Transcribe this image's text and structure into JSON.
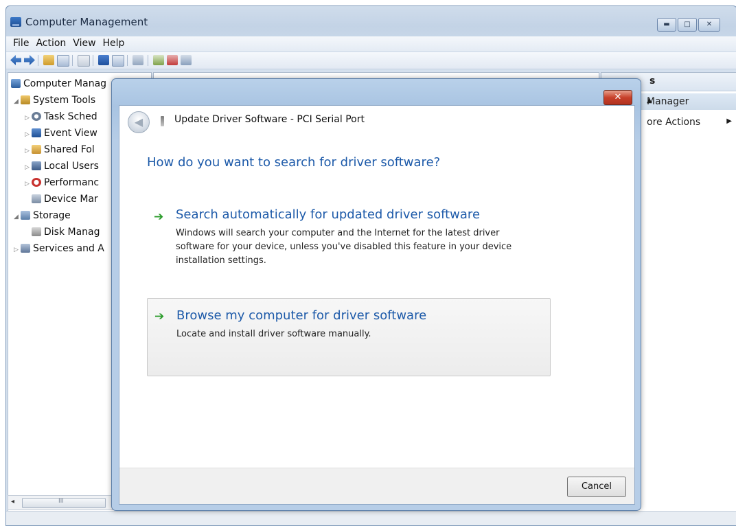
{
  "window": {
    "title": "Computer Management",
    "controls": {
      "minimize": "▬",
      "maximize": "□",
      "close": "✕"
    }
  },
  "menubar": {
    "items": [
      "File",
      "Action",
      "View",
      "Help"
    ]
  },
  "tree": {
    "items": [
      {
        "label": "Computer Manag",
        "icon": "computer-icon"
      },
      {
        "label": "System Tools",
        "icon": "tools-icon"
      },
      {
        "label": "Task Sched",
        "icon": "clock-icon"
      },
      {
        "label": "Event View",
        "icon": "event-viewer-icon"
      },
      {
        "label": "Shared Fol",
        "icon": "shared-folder-icon"
      },
      {
        "label": "Local Users",
        "icon": "users-icon"
      },
      {
        "label": "Performanc",
        "icon": "performance-icon"
      },
      {
        "label": "Device Mar",
        "icon": "device-manager-icon"
      },
      {
        "label": "Storage",
        "icon": "storage-icon"
      },
      {
        "label": "Disk Manag",
        "icon": "disk-icon"
      },
      {
        "label": "Services and A",
        "icon": "services-icon"
      }
    ],
    "scroll_glyph": "◂",
    "thumb_glyph": "III"
  },
  "actions": {
    "header": "s",
    "section": "Manager",
    "section_arrow": "▲",
    "more": "ore Actions",
    "more_arrow": "▶"
  },
  "dialog": {
    "close_label": "✕",
    "back_glyph": "◀",
    "title": "Update Driver Software - PCI Serial Port",
    "question": "How do you want to search for driver software?",
    "option1": {
      "arrow": "➔",
      "title": "Search automatically for updated driver software",
      "desc_lines": [
        "Windows will search your computer and the Internet for the latest driver",
        "software for your device, unless you've disabled this feature in your device",
        "installation settings."
      ]
    },
    "option2": {
      "arrow": "➔",
      "title": "Browse my computer for driver software",
      "desc": "Locate and install driver software manually."
    },
    "cancel_label": "Cancel"
  },
  "colors": {
    "accent_blue": "#1d5aa9",
    "arrow_green": "#2a9b2a",
    "close_red": "#c7412b"
  }
}
